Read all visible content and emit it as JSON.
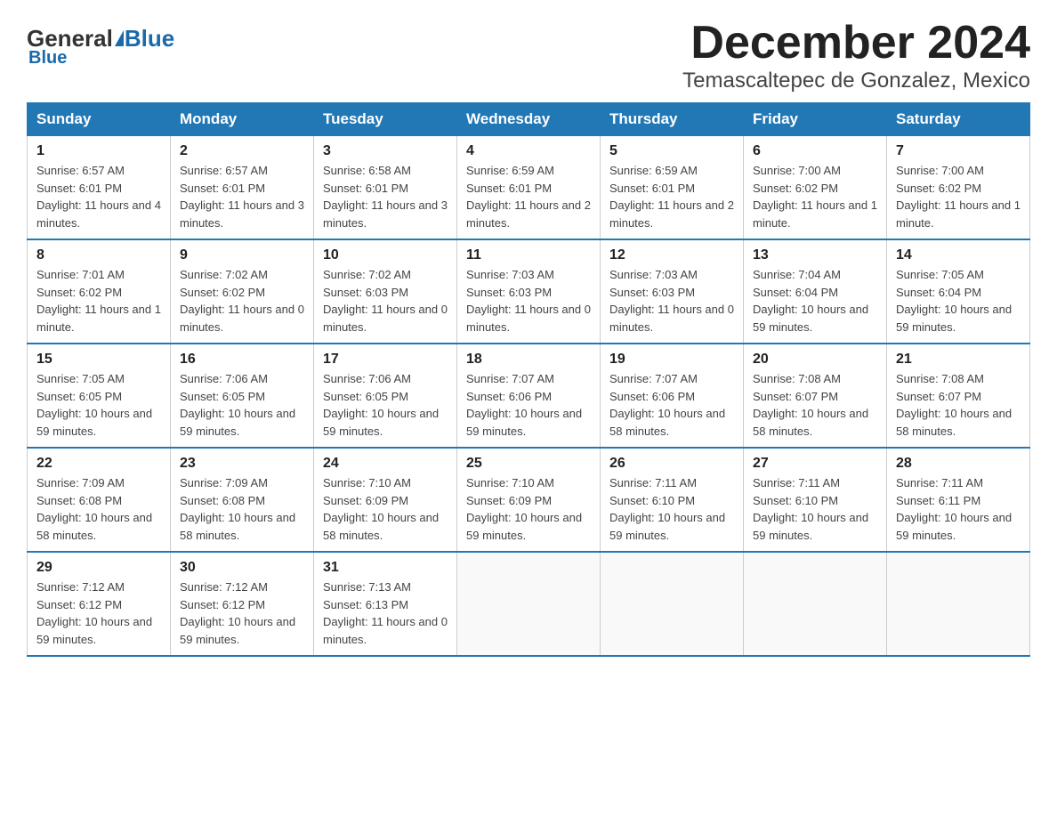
{
  "logo": {
    "general": "General",
    "blue": "Blue"
  },
  "title": "December 2024",
  "subtitle": "Temascaltepec de Gonzalez, Mexico",
  "days_of_week": [
    "Sunday",
    "Monday",
    "Tuesday",
    "Wednesday",
    "Thursday",
    "Friday",
    "Saturday"
  ],
  "weeks": [
    [
      {
        "day": "1",
        "sunrise": "6:57 AM",
        "sunset": "6:01 PM",
        "daylight": "11 hours and 4 minutes."
      },
      {
        "day": "2",
        "sunrise": "6:57 AM",
        "sunset": "6:01 PM",
        "daylight": "11 hours and 3 minutes."
      },
      {
        "day": "3",
        "sunrise": "6:58 AM",
        "sunset": "6:01 PM",
        "daylight": "11 hours and 3 minutes."
      },
      {
        "day": "4",
        "sunrise": "6:59 AM",
        "sunset": "6:01 PM",
        "daylight": "11 hours and 2 minutes."
      },
      {
        "day": "5",
        "sunrise": "6:59 AM",
        "sunset": "6:01 PM",
        "daylight": "11 hours and 2 minutes."
      },
      {
        "day": "6",
        "sunrise": "7:00 AM",
        "sunset": "6:02 PM",
        "daylight": "11 hours and 1 minute."
      },
      {
        "day": "7",
        "sunrise": "7:00 AM",
        "sunset": "6:02 PM",
        "daylight": "11 hours and 1 minute."
      }
    ],
    [
      {
        "day": "8",
        "sunrise": "7:01 AM",
        "sunset": "6:02 PM",
        "daylight": "11 hours and 1 minute."
      },
      {
        "day": "9",
        "sunrise": "7:02 AM",
        "sunset": "6:02 PM",
        "daylight": "11 hours and 0 minutes."
      },
      {
        "day": "10",
        "sunrise": "7:02 AM",
        "sunset": "6:03 PM",
        "daylight": "11 hours and 0 minutes."
      },
      {
        "day": "11",
        "sunrise": "7:03 AM",
        "sunset": "6:03 PM",
        "daylight": "11 hours and 0 minutes."
      },
      {
        "day": "12",
        "sunrise": "7:03 AM",
        "sunset": "6:03 PM",
        "daylight": "11 hours and 0 minutes."
      },
      {
        "day": "13",
        "sunrise": "7:04 AM",
        "sunset": "6:04 PM",
        "daylight": "10 hours and 59 minutes."
      },
      {
        "day": "14",
        "sunrise": "7:05 AM",
        "sunset": "6:04 PM",
        "daylight": "10 hours and 59 minutes."
      }
    ],
    [
      {
        "day": "15",
        "sunrise": "7:05 AM",
        "sunset": "6:05 PM",
        "daylight": "10 hours and 59 minutes."
      },
      {
        "day": "16",
        "sunrise": "7:06 AM",
        "sunset": "6:05 PM",
        "daylight": "10 hours and 59 minutes."
      },
      {
        "day": "17",
        "sunrise": "7:06 AM",
        "sunset": "6:05 PM",
        "daylight": "10 hours and 59 minutes."
      },
      {
        "day": "18",
        "sunrise": "7:07 AM",
        "sunset": "6:06 PM",
        "daylight": "10 hours and 59 minutes."
      },
      {
        "day": "19",
        "sunrise": "7:07 AM",
        "sunset": "6:06 PM",
        "daylight": "10 hours and 58 minutes."
      },
      {
        "day": "20",
        "sunrise": "7:08 AM",
        "sunset": "6:07 PM",
        "daylight": "10 hours and 58 minutes."
      },
      {
        "day": "21",
        "sunrise": "7:08 AM",
        "sunset": "6:07 PM",
        "daylight": "10 hours and 58 minutes."
      }
    ],
    [
      {
        "day": "22",
        "sunrise": "7:09 AM",
        "sunset": "6:08 PM",
        "daylight": "10 hours and 58 minutes."
      },
      {
        "day": "23",
        "sunrise": "7:09 AM",
        "sunset": "6:08 PM",
        "daylight": "10 hours and 58 minutes."
      },
      {
        "day": "24",
        "sunrise": "7:10 AM",
        "sunset": "6:09 PM",
        "daylight": "10 hours and 58 minutes."
      },
      {
        "day": "25",
        "sunrise": "7:10 AM",
        "sunset": "6:09 PM",
        "daylight": "10 hours and 59 minutes."
      },
      {
        "day": "26",
        "sunrise": "7:11 AM",
        "sunset": "6:10 PM",
        "daylight": "10 hours and 59 minutes."
      },
      {
        "day": "27",
        "sunrise": "7:11 AM",
        "sunset": "6:10 PM",
        "daylight": "10 hours and 59 minutes."
      },
      {
        "day": "28",
        "sunrise": "7:11 AM",
        "sunset": "6:11 PM",
        "daylight": "10 hours and 59 minutes."
      }
    ],
    [
      {
        "day": "29",
        "sunrise": "7:12 AM",
        "sunset": "6:12 PM",
        "daylight": "10 hours and 59 minutes."
      },
      {
        "day": "30",
        "sunrise": "7:12 AM",
        "sunset": "6:12 PM",
        "daylight": "10 hours and 59 minutes."
      },
      {
        "day": "31",
        "sunrise": "7:13 AM",
        "sunset": "6:13 PM",
        "daylight": "11 hours and 0 minutes."
      },
      null,
      null,
      null,
      null
    ]
  ]
}
